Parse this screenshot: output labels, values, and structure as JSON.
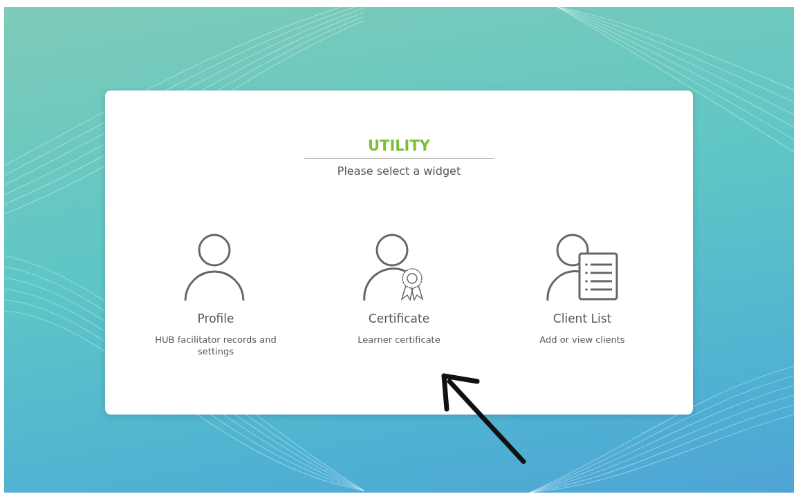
{
  "dialog": {
    "title": "UTILITY",
    "subtitle": "Please select a widget",
    "widgets": [
      {
        "kind": "profile",
        "label": "Profile",
        "description": "HUB facilitator records and settings"
      },
      {
        "kind": "certificate",
        "label": "Certificate",
        "description": "Learner certificate"
      },
      {
        "kind": "client-list",
        "label": "Client List",
        "description": "Add or view clients"
      }
    ]
  }
}
